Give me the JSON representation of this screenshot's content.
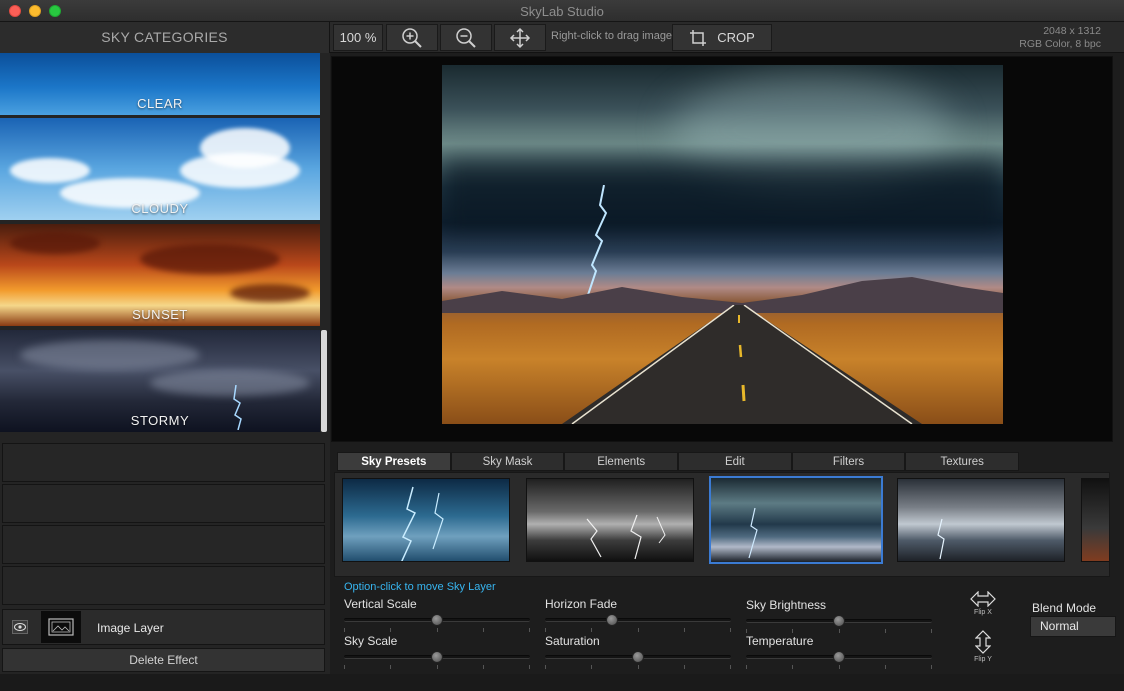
{
  "window": {
    "title": "SkyLab Studio"
  },
  "toolbar": {
    "sky_categories_title": "SKY CATEGORIES",
    "zoom_level": "100 %",
    "zoom_in_icon": "zoom-in-icon",
    "zoom_out_icon": "zoom-out-icon",
    "move_icon": "move-arrows-icon",
    "drag_hint": "Right-click to drag image",
    "crop_label": "CROP",
    "image_dimensions": "2048 x 1312",
    "image_color_info": "RGB Color, 8 bpc"
  },
  "categories": [
    {
      "label": "CLEAR"
    },
    {
      "label": "CLOUDY"
    },
    {
      "label": "SUNSET"
    },
    {
      "label": "STORMY"
    }
  ],
  "layers": {
    "image_layer_label": "Image Layer",
    "delete_effect_label": "Delete Effect"
  },
  "tabs": [
    {
      "label": "Sky Presets",
      "active": true
    },
    {
      "label": "Sky Mask",
      "active": false
    },
    {
      "label": "Elements",
      "active": false
    },
    {
      "label": "Edit",
      "active": false
    },
    {
      "label": "Filters",
      "active": false
    },
    {
      "label": "Textures",
      "active": false
    }
  ],
  "hint": "Option-click to move Sky Layer",
  "sliders": {
    "vertical_scale": {
      "label": "Vertical Scale",
      "value": 0.5
    },
    "horizon_fade": {
      "label": "Horizon Fade",
      "value": 0.36
    },
    "sky_brightness": {
      "label": "Sky Brightness",
      "value": 0.5
    },
    "sky_scale": {
      "label": "Sky Scale",
      "value": 0.5
    },
    "saturation": {
      "label": "Saturation",
      "value": 0.5
    },
    "temperature": {
      "label": "Temperature",
      "value": 0.5
    }
  },
  "flip": {
    "flip_x_label": "Flip X",
    "flip_y_label": "Flip Y"
  },
  "blend": {
    "label": "Blend Mode",
    "value": "Normal"
  },
  "colors": {
    "accent_blue": "#3b7bd3",
    "hint_cyan": "#37b5f0",
    "close": "#fc5f57",
    "minimize": "#fdbc2e",
    "maximize": "#28c840"
  }
}
